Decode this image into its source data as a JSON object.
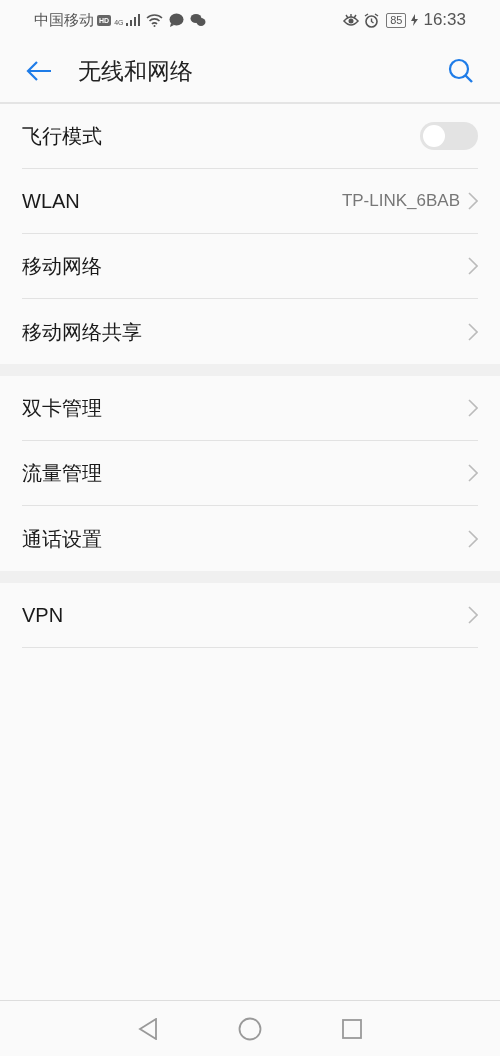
{
  "status_bar": {
    "carrier": "中国移动",
    "hd_badge": "HD",
    "network": "4G",
    "battery": "85",
    "time": "16:33"
  },
  "header": {
    "title": "无线和网络"
  },
  "groups": [
    {
      "rows": [
        {
          "kind": "toggle",
          "label": "飞行模式",
          "on": false
        },
        {
          "kind": "link",
          "label": "WLAN",
          "value": "TP-LINK_6BAB"
        },
        {
          "kind": "link",
          "label": "移动网络"
        },
        {
          "kind": "link",
          "label": "移动网络共享"
        }
      ]
    },
    {
      "rows": [
        {
          "kind": "link",
          "label": "双卡管理"
        },
        {
          "kind": "link",
          "label": "流量管理"
        },
        {
          "kind": "link",
          "label": "通话设置"
        }
      ]
    },
    {
      "rows": [
        {
          "kind": "link",
          "label": "VPN"
        }
      ]
    }
  ]
}
